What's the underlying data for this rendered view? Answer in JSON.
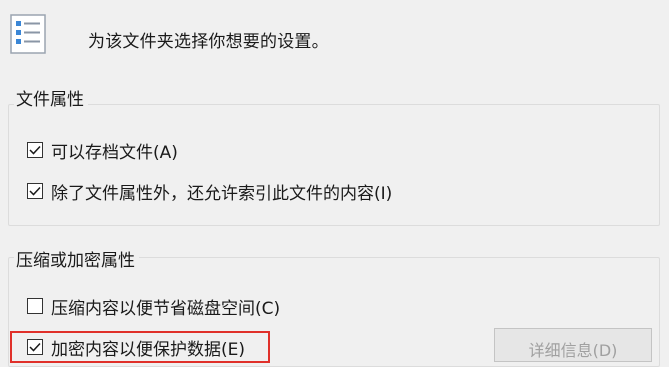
{
  "header": {
    "description": "为该文件夹选择你想要的设置。"
  },
  "attributes_group": {
    "title": "文件属性",
    "options": [
      {
        "label": "可以存档文件(A)",
        "checked": true
      },
      {
        "label": "除了文件属性外，还允许索引此文件的内容(I)",
        "checked": true
      }
    ]
  },
  "compress_group": {
    "title": "压缩或加密属性",
    "options": [
      {
        "label": "压缩内容以便节省磁盘空间(C)",
        "checked": false
      },
      {
        "label": "加密内容以便保护数据(E)",
        "checked": true
      }
    ],
    "details_button": {
      "label": "详细信息(D)",
      "enabled": false
    }
  },
  "colors": {
    "highlight": "#e0302a",
    "background": "#f0f0f0"
  }
}
